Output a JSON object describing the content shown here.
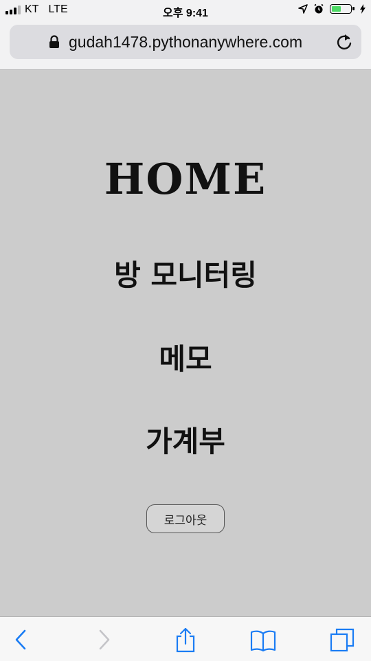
{
  "status_bar": {
    "carrier": "KT",
    "network": "LTE",
    "time": "오후 9:41"
  },
  "address_bar": {
    "url": "gudah1478.pythonanywhere.com"
  },
  "page": {
    "title": "HOME",
    "links": [
      {
        "label": "방 모니터링"
      },
      {
        "label": "메모"
      },
      {
        "label": "가계부"
      }
    ],
    "logout_label": "로그아웃"
  },
  "colors": {
    "page_background": "#cccccc",
    "browser_chrome": "#f2f2f3",
    "toolbar_accent": "#1a7cf4",
    "battery_fill": "#4cd964"
  },
  "icons": {
    "status": [
      "signal-icon",
      "location-icon",
      "alarm-icon",
      "battery-icon",
      "charging-icon"
    ],
    "toolbar": [
      "back-icon",
      "forward-icon",
      "share-icon",
      "bookmarks-icon",
      "tabs-icon"
    ]
  }
}
